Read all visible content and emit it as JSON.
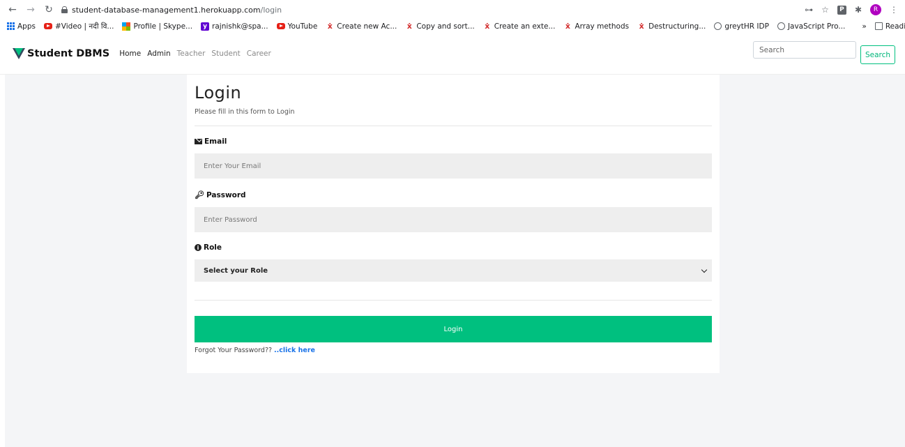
{
  "browser": {
    "url_host": "student-database-management1.herokuapp.com",
    "url_path": "/login",
    "avatar_letter": "R",
    "ext_letter": "P",
    "bookmarks": [
      {
        "label": "Apps",
        "icon": "apps-grid-icon"
      },
      {
        "label": "#Video | नदी वि...",
        "icon": "youtube-icon"
      },
      {
        "label": "Profile | Skype...",
        "icon": "microsoft-icon"
      },
      {
        "label": "rajnishk@spa...",
        "icon": "yahoo-icon"
      },
      {
        "label": "YouTube",
        "icon": "youtube-icon"
      },
      {
        "label": "Create new Ac...",
        "icon": "x-icon"
      },
      {
        "label": "Copy and sort...",
        "icon": "x-icon"
      },
      {
        "label": "Create an exte...",
        "icon": "x-icon"
      },
      {
        "label": "Array methods",
        "icon": "x-icon"
      },
      {
        "label": "Destructuring...",
        "icon": "x-icon"
      },
      {
        "label": "greytHR IDP",
        "icon": "globe-icon"
      },
      {
        "label": "JavaScript Pro...",
        "icon": "globe-icon"
      }
    ],
    "more_label": "»",
    "reading_list": "Reading list"
  },
  "nav": {
    "brand": "Student DBMS",
    "links": [
      "Home",
      "Admin",
      "Teacher",
      "Student",
      "Career"
    ],
    "search_placeholder": "Search",
    "search_button": "Search"
  },
  "form": {
    "title": "Login",
    "subtitle": "Please fill in this form to Login",
    "email_label": "Email",
    "email_placeholder": "Enter Your Email",
    "password_label": "Password",
    "password_placeholder": "Enter Password",
    "role_label": "Role",
    "role_selected": "Select your Role",
    "login_button": "Login",
    "forgot_text": "Forgot Your Password?? ",
    "forgot_link": "..click here"
  },
  "colors": {
    "accent": "#00c07f",
    "link": "#1a73e8",
    "logo_dark": "#34495e",
    "logo_green": "#00c07f"
  }
}
